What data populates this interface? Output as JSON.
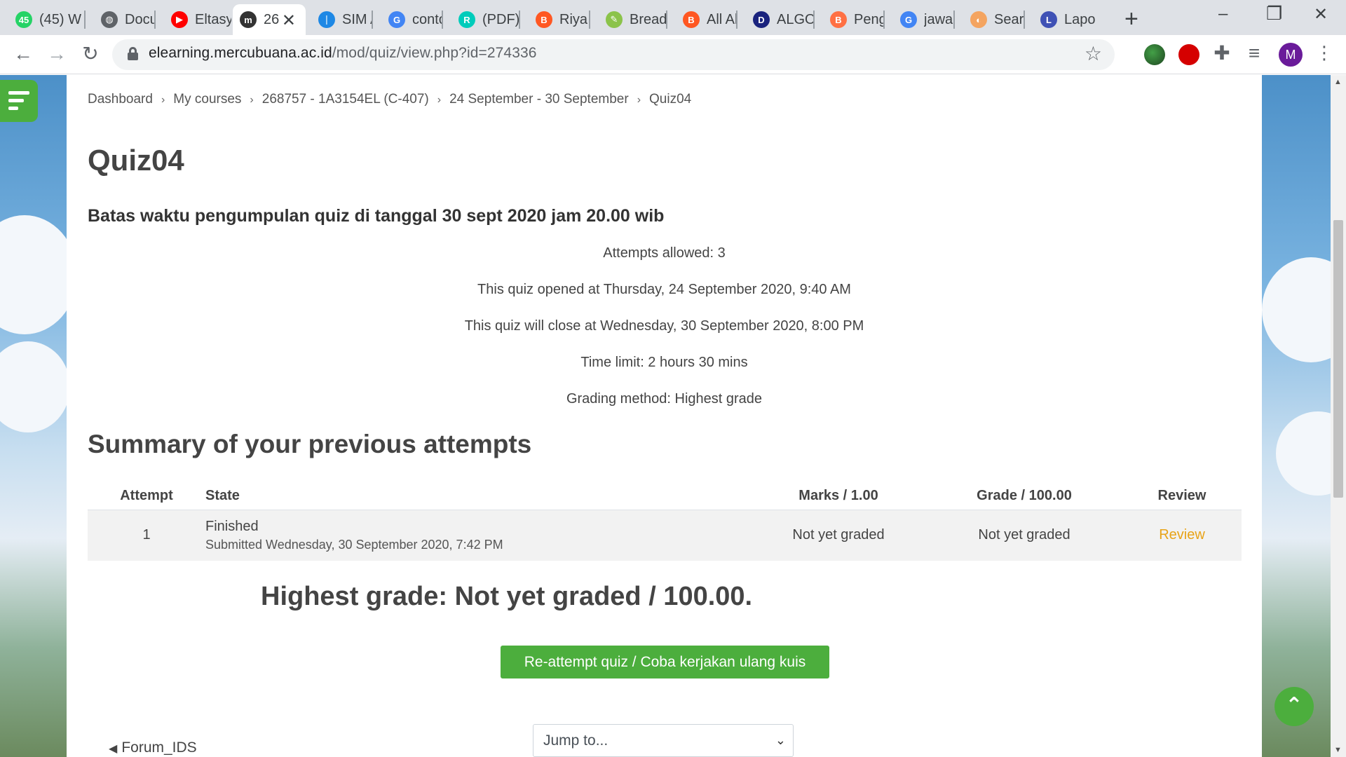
{
  "browser": {
    "tabs": [
      {
        "title": "(45) W",
        "favicon": "whatsapp-icon",
        "color": "#25d366",
        "glyph": "45"
      },
      {
        "title": "Docu",
        "favicon": "globe-icon",
        "color": "#5f6368",
        "glyph": "◍"
      },
      {
        "title": "Eltasy",
        "favicon": "youtube-icon",
        "color": "#ff0000",
        "glyph": "▶"
      },
      {
        "title": "26",
        "favicon": "moodle-icon",
        "color": "#333333",
        "glyph": "m"
      },
      {
        "title": "SIM A",
        "favicon": "sim-icon",
        "color": "#1e88e5",
        "glyph": "❘"
      },
      {
        "title": "conto",
        "favicon": "google-icon",
        "color": "#4285f4",
        "glyph": "G"
      },
      {
        "title": "(PDF)",
        "favicon": "researchgate-icon",
        "color": "#00ccbb",
        "glyph": "R"
      },
      {
        "title": "Riya A",
        "favicon": "blogger-icon",
        "color": "#ff5722",
        "glyph": "B"
      },
      {
        "title": "Bread",
        "favicon": "bread-icon",
        "color": "#8bc34a",
        "glyph": "✎"
      },
      {
        "title": "All Ab",
        "favicon": "blogger-icon",
        "color": "#ff5722",
        "glyph": "B"
      },
      {
        "title": "ALGO",
        "favicon": "dictio-icon",
        "color": "#1a237e",
        "glyph": "D"
      },
      {
        "title": "Penge",
        "favicon": "blogger-icon",
        "color": "#ff7043",
        "glyph": "B"
      },
      {
        "title": "jawab",
        "favicon": "google-icon",
        "color": "#4285f4",
        "glyph": "G"
      },
      {
        "title": "Searc",
        "favicon": "search-engine-icon",
        "color": "#f4a460",
        "glyph": "◐"
      },
      {
        "title": "Lapor",
        "favicon": "lapor-icon",
        "color": "#3f51b5",
        "glyph": "L"
      }
    ],
    "active_tab_index": 3,
    "url_host": "elearning.mercubuana.ac.id",
    "url_path": "/mod/quiz/view.php?id=274336",
    "profile_initial": "M"
  },
  "page": {
    "breadcrumb": [
      "Dashboard",
      "My courses",
      "268757 - 1A3154EL (C-407)",
      "24 September - 30 September",
      "Quiz04"
    ],
    "title": "Quiz04",
    "intro": "Batas waktu pengumpulan quiz di tanggal 30 sept 2020 jam 20.00 wib",
    "info": {
      "attempts_allowed": "Attempts allowed: 3",
      "opened": "This quiz opened at Thursday, 24 September 2020, 9:40 AM",
      "close": "This quiz will close at Wednesday, 30 September 2020, 8:00 PM",
      "time_limit": "Time limit: 2 hours 30 mins",
      "grading_method": "Grading method: Highest grade"
    },
    "summary_title": "Summary of your previous attempts",
    "table": {
      "headers": {
        "attempt": "Attempt",
        "state": "State",
        "marks": "Marks / 1.00",
        "grade": "Grade / 100.00",
        "review": "Review"
      },
      "rows": [
        {
          "attempt": "1",
          "state": "Finished",
          "submitted": "Submitted Wednesday, 30 September 2020, 7:42 PM",
          "marks": "Not yet graded",
          "grade": "Not yet graded",
          "review": "Review"
        }
      ]
    },
    "highest_grade": "Highest grade: Not yet graded / 100.00.",
    "reattempt_label": "Re-attempt quiz / Coba kerjakan ulang kuis",
    "prev_activity": "Forum_IDS",
    "jump_to": "Jump to..."
  },
  "colors": {
    "brand_green": "#4cae3d",
    "review_link": "#e8a317"
  }
}
